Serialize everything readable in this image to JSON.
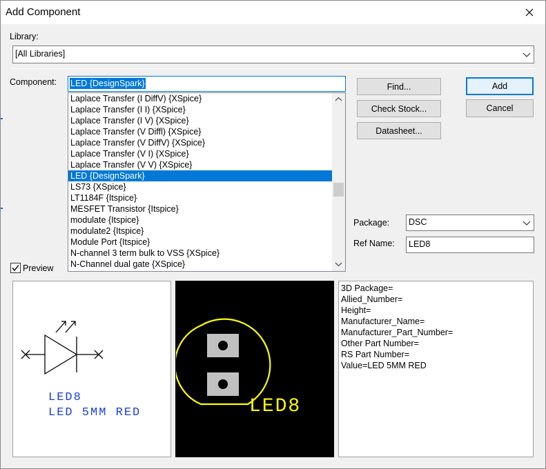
{
  "window": {
    "title": "Add Component"
  },
  "library": {
    "label": "Library:",
    "value": "[All Libraries]"
  },
  "component": {
    "label": "Component:",
    "value": "LED {DesignSpark}"
  },
  "buttons": {
    "find": "Find...",
    "check_stock": "Check Stock...",
    "datasheet": "Datasheet...",
    "add": "Add",
    "cancel": "Cancel"
  },
  "list": {
    "items": [
      "Laplace Transfer (I DiffV) {XSpice}",
      "Laplace Transfer (I I) {XSpice}",
      "Laplace Transfer (I V) {XSpice}",
      "Laplace Transfer (V Diffl) {XSpice}",
      "Laplace Transfer (V DiffV) {XSpice}",
      "Laplace Transfer (V I) {XSpice}",
      "Laplace Transfer (V V) {XSpice}",
      "LED {DesignSpark}",
      "LS73 {XSpice}",
      "LT1184F {Itspice}",
      "MESFET Transistor {Itspice}",
      "modulate {Itspice}",
      "modulate2 {Itspice}",
      "Module Port {Itspice}",
      "N-channel 3 term bulk to VSS {XSpice}",
      "N-Channel dual gate {XSpice}"
    ],
    "selected_index": 7
  },
  "package": {
    "label": "Package:",
    "value": "DSC"
  },
  "ref_name": {
    "label": "Ref Name:",
    "value": "LED8"
  },
  "preview": {
    "label": "Preview",
    "checked": true
  },
  "schematic": {
    "ref": "LED8",
    "value": "LED 5MM RED"
  },
  "pcb": {
    "ref": "LED8"
  },
  "properties": [
    "3D Package=",
    "Allied_Number=",
    "Height=",
    "Manufacturer_Name=",
    "Manufacturer_Part_Number=",
    "Other Part Number=",
    "RS Part Number=",
    "Value=LED 5MM RED"
  ],
  "colors": {
    "selection": "#0078d7",
    "schematic_text": "#1a3fd6",
    "pcb_outline": "#ffff00",
    "pcb_background": "#000000"
  }
}
